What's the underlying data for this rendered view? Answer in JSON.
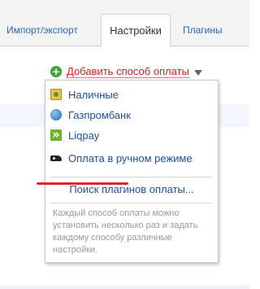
{
  "tabs": [
    {
      "label": "Импорт/экспорт"
    },
    {
      "label": "Настройки"
    },
    {
      "label": "Плагины"
    }
  ],
  "add_method": {
    "label": "Добавить способ оплаты"
  },
  "dropdown": {
    "items": [
      {
        "label": "Наличные",
        "icon": "cash-icon"
      },
      {
        "label": "Газпромбанк",
        "icon": "gazprombank-icon"
      },
      {
        "label": "Liqpay",
        "icon": "liqpay-icon"
      },
      {
        "label": "Оплата в ручном режиме",
        "icon": "manual-payment-icon"
      }
    ],
    "search_link": "Поиск плагинов оплаты...",
    "help_text": "Каждый способ оплаты можно установить несколько раз и задать каждому способу различные настройки."
  },
  "colors": {
    "link": "#1f4f91",
    "add_link": "#cc2222",
    "highlight_underline": "#d12b2b"
  }
}
